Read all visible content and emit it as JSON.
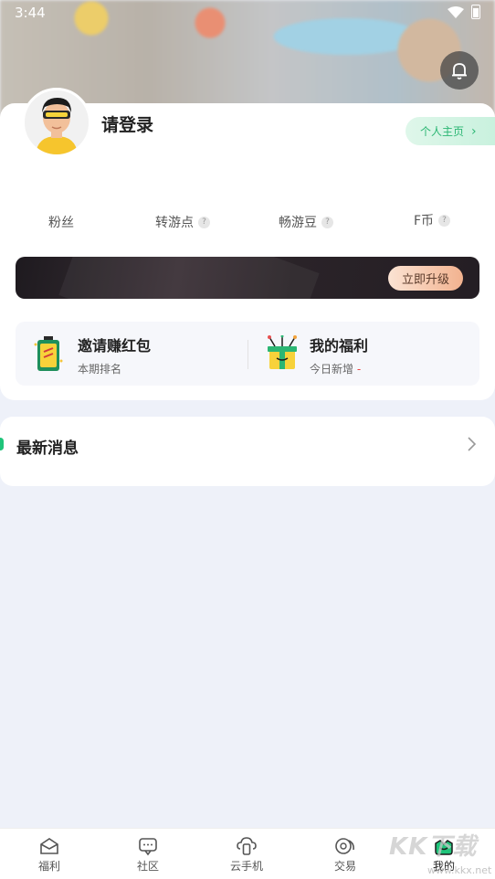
{
  "status_bar": {
    "time": "3:44"
  },
  "profile": {
    "login_prompt": "请登录",
    "homepage_label": "个人主页"
  },
  "stats": {
    "items": [
      {
        "label": "粉丝",
        "help": false
      },
      {
        "label": "转游点",
        "help": true
      },
      {
        "label": "畅游豆",
        "help": true
      },
      {
        "label": "F币",
        "help": true
      }
    ],
    "help_glyph": "?"
  },
  "vip": {
    "upgrade_label": "立即升级"
  },
  "benefits": {
    "invite": {
      "title": "邀请赚红包",
      "subtitle": "本期排名"
    },
    "welfare": {
      "title": "我的福利",
      "subtitle": "今日新增",
      "value": "-"
    }
  },
  "news": {
    "title": "最新消息"
  },
  "bottom_nav": {
    "items": [
      {
        "label": "福利",
        "icon": "gift-box-icon"
      },
      {
        "label": "社区",
        "icon": "chat-bubble-icon"
      },
      {
        "label": "云手机",
        "icon": "cloud-phone-icon"
      },
      {
        "label": "交易",
        "icon": "trade-coins-icon"
      },
      {
        "label": "我的",
        "icon": "profile-crown-icon",
        "active": true
      }
    ]
  },
  "watermark": {
    "main": "KK下载",
    "sub": "www.kkx.net"
  },
  "colors": {
    "accent": "#1fc47a",
    "homepage_text": "#2bb673",
    "upgrade_gradient_end": "#f2b28f",
    "page_bg": "#eef1f9"
  }
}
